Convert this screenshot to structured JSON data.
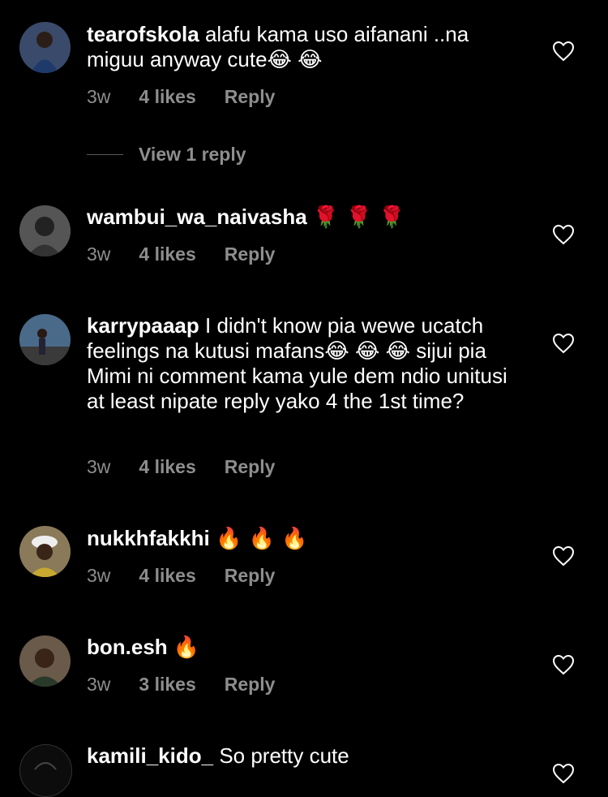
{
  "comments": [
    {
      "username": "tearofskola",
      "text": "alafu kama uso aifanani ..na miguu anyway cute😂 😂",
      "time": "3w",
      "likes": "4 likes",
      "reply": "Reply",
      "view_replies": "View 1 reply",
      "avatar_color": "#3a4a6a"
    },
    {
      "username": "wambui_wa_naivasha",
      "text": "🌹 🌹 🌹",
      "time": "3w",
      "likes": "4 likes",
      "reply": "Reply",
      "avatar_color": "#555555"
    },
    {
      "username": "karrypaaap",
      "text": "I didn't know pia wewe ucatch feelings na kutusi mafans😂 😂 😂  sijui pia Mimi ni comment kama yule dem ndio unitusi at least nipate reply yako 4 the 1st time?",
      "time": "3w",
      "likes": "4 likes",
      "reply": "Reply",
      "avatar_color": "#4a6a8a"
    },
    {
      "username": "nukkhfakkhi",
      "text": "🔥 🔥 🔥",
      "time": "3w",
      "likes": "4 likes",
      "reply": "Reply",
      "avatar_color": "#8a7a5a"
    },
    {
      "username": "bon.esh",
      "text": "🔥",
      "time": "3w",
      "likes": "3 likes",
      "reply": "Reply",
      "avatar_color": "#6a5a4a"
    },
    {
      "username": "kamili_kido_",
      "text": "So pretty cute",
      "avatar_color": "#111111"
    }
  ],
  "colors": {
    "background": "#000000",
    "text": "#ffffff",
    "meta": "#8e8e8e"
  },
  "icons": {
    "like": "heart-outline-icon"
  }
}
